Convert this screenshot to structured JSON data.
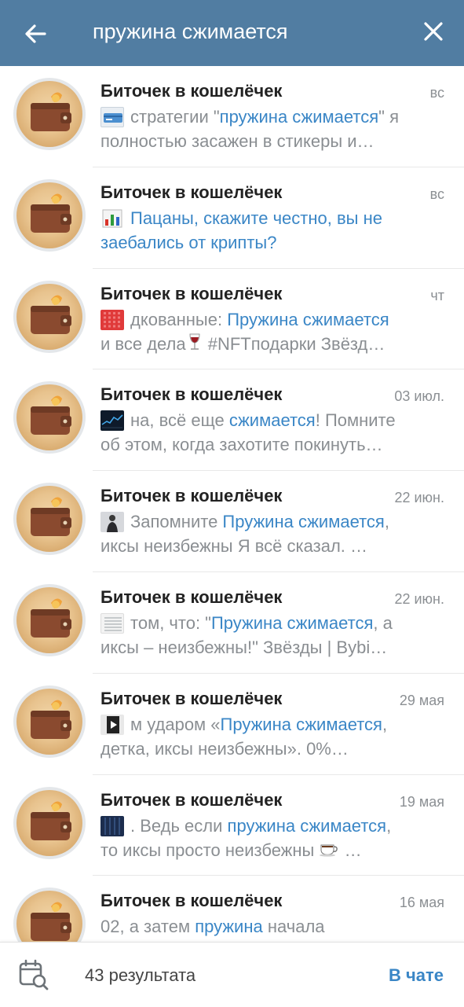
{
  "header": {
    "query": "пружина сжимается",
    "back_icon": "arrow-left-icon",
    "close_icon": "close-icon"
  },
  "results": [
    {
      "chat": "Биточек в кошелёчек",
      "date": "вс",
      "thumb": "card-thumb",
      "line1": [
        {
          "t": "стратегии \"",
          "h": false
        },
        {
          "t": "пружина сжимается",
          "h": true
        },
        {
          "t": "\" я",
          "h": false
        }
      ],
      "line2": [
        {
          "t": "полностью засажен в стикеры и…",
          "h": false
        }
      ]
    },
    {
      "chat": "Биточек в кошелёчек",
      "date": "вс",
      "thumb": "bar-chart-emoji",
      "line1": [
        {
          "t": "Пацаны, скажите честно, вы не",
          "h": true
        }
      ],
      "line2": [
        {
          "t": "заебались от крипты?",
          "h": true
        }
      ]
    },
    {
      "chat": "Биточек в кошелёчек",
      "date": "чт",
      "thumb": "red-grid-thumb",
      "line1": [
        {
          "t": "дкованные:  ",
          "h": false
        },
        {
          "t": "Пружина сжимается",
          "h": true
        }
      ],
      "line2": [
        {
          "t": "и все дела",
          "h": false
        },
        {
          "t": "🍷",
          "h": false,
          "emoji": "wine-glass-emoji"
        },
        {
          "t": "  #NFTподарки  Звёзд…",
          "h": false
        }
      ]
    },
    {
      "chat": "Биточек в кошелёчек",
      "date": "03 июл.",
      "thumb": "dark-chart-thumb",
      "line1": [
        {
          "t": "на, всё еще ",
          "h": false
        },
        {
          "t": "сжимается",
          "h": true
        },
        {
          "t": "! Помните",
          "h": false
        }
      ],
      "line2": [
        {
          "t": "об этом, когда захотите покинуть…",
          "h": false
        }
      ]
    },
    {
      "chat": "Биточек в кошелёчек",
      "date": "22 июн.",
      "thumb": "person-photo-thumb",
      "line1": [
        {
          "t": "Запомните  ",
          "h": false
        },
        {
          "t": "Пружина сжимается",
          "h": true
        },
        {
          "t": ",",
          "h": false
        }
      ],
      "line2": [
        {
          "t": "иксы неизбежны   Я всё сказал.  …",
          "h": false
        }
      ]
    },
    {
      "chat": "Биточек в кошелёчек",
      "date": "22 июн.",
      "thumb": "document-thumb",
      "line1": [
        {
          "t": "том, что: \"",
          "h": false
        },
        {
          "t": "Пружина сжимается",
          "h": true
        },
        {
          "t": ", а",
          "h": false
        }
      ],
      "line2": [
        {
          "t": "иксы – неизбежны!\"  Звёзды | Bybi…",
          "h": false
        }
      ]
    },
    {
      "chat": "Биточек в кошелёчек",
      "date": "29 мая",
      "thumb": "video-thumb",
      "line1": [
        {
          "t": "м ударом  «",
          "h": false
        },
        {
          "t": "Пружина сжимается",
          "h": true
        },
        {
          "t": ",",
          "h": false
        }
      ],
      "line2": [
        {
          "t": "детка, иксы неизбежны».  0%…",
          "h": false
        }
      ]
    },
    {
      "chat": "Биточек в кошелёчек",
      "date": "19 мая",
      "thumb": "navy-grid-thumb",
      "line1": [
        {
          "t": ". Ведь если ",
          "h": false
        },
        {
          "t": "пружина сжимается",
          "h": true
        },
        {
          "t": ",",
          "h": false
        }
      ],
      "line2": [
        {
          "t": "то иксы просто неизбежны ",
          "h": false
        },
        {
          "t": "☕",
          "h": false,
          "emoji": "coffee-emoji"
        },
        {
          "t": " …",
          "h": false
        }
      ]
    },
    {
      "chat": "Биточек в кошелёчек",
      "date": "16 мая",
      "thumb": "",
      "line1": [
        {
          "t": "02, а затем ",
          "h": false
        },
        {
          "t": "пружина",
          "h": true
        },
        {
          "t": " начала",
          "h": false
        }
      ],
      "line2": []
    }
  ],
  "footer": {
    "count_label": "43 результата",
    "in_chat_label": "В чате",
    "calendar_icon": "calendar-search-icon"
  },
  "colors": {
    "header": "#517da2",
    "highlight": "#3a86c6",
    "secondary": "#8a8e92"
  }
}
